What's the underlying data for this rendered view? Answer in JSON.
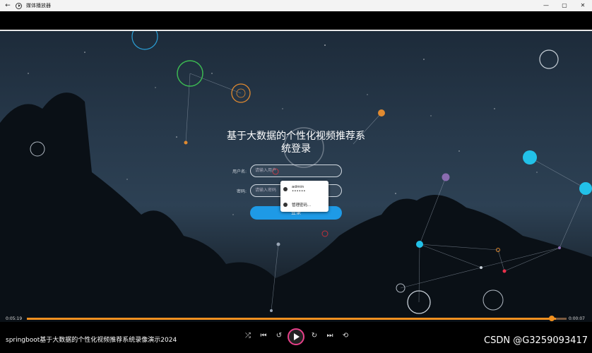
{
  "window": {
    "title": "媒体播放器",
    "back": "←",
    "minimize": "—",
    "maximize": "▢",
    "close": "✕"
  },
  "login": {
    "title_line1": "基于大数据的个性化视频推荐系",
    "title_line2": "统登录",
    "username_label": "用户名:",
    "username_placeholder": "请输入用户",
    "password_label": "密码:",
    "password_placeholder": "请输入密码",
    "login_button": "登录"
  },
  "autofill": {
    "account": "admin",
    "password_mask": "••••••",
    "manage": "管理密码..."
  },
  "player": {
    "elapsed": "0:05:19",
    "remaining": "0:00:07",
    "progress_fraction": 0.98,
    "caption": "springboot基于大数据的个性化视频推荐系统录像演示2024",
    "watermark": "CSDN @G3259093417"
  }
}
